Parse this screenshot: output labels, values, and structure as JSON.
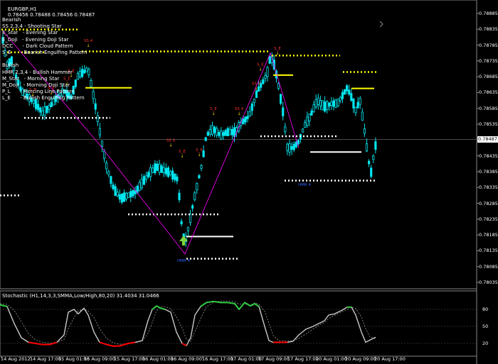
{
  "header": {
    "symbol_label": "EURGBP,H1",
    "ohlc": "0.78456 0.78488 0.78456 0.78487"
  },
  "legend": {
    "lines": [
      "Bearish",
      "SS 2,3,4 - Shooting Star",
      "E_Star   - Evening Star",
      "E_Doji   - Evening Doji Star",
      "DCC      - Dark Cloud Pattern",
      "S_E      - Bearish Engulfing Pattern",
      "",
      "Bullish",
      "HMR 2,3,4 - Bullish Hammer",
      "M_Star   - Morning Star",
      "M_Doji   - Morning Doji Star",
      "P_L      - Piercing Line Pattern",
      "L_E      - Bullish Engulfing Pattern"
    ]
  },
  "stochastic": {
    "title": "Stochastic (H1,14,3,3,SMMA,Low/High,80,20) 31.4034 31.0466"
  },
  "colors": {
    "background": "#000000",
    "candle": "#00e5ee",
    "support_line": "#ffffff",
    "resistance_line": "#ffff00",
    "zigzag": "#ff00ff",
    "stoch_main": "#c8c8c8",
    "stoch_overbought": "#2ecc40",
    "stoch_oversold": "#ff0000",
    "price_tag_bg": "#ffffff"
  },
  "current_price": "0.78487",
  "chart_data": {
    "type": "candlestick",
    "price_axis": [
      "0.78885",
      "0.78835",
      "0.78785",
      "0.78735",
      "0.78685",
      "0.78635",
      "0.78585",
      "0.78535",
      "0.78487",
      "0.78435",
      "0.78385",
      "0.78335",
      "0.78285",
      "0.78235",
      "0.78185",
      "0.78135",
      "0.78085",
      "0.78035"
    ],
    "ylim": [
      0.78015,
      0.78905
    ],
    "time_axis": [
      "14 Aug 2012",
      "14 Aug 17:00",
      "15 Aug 01:00",
      "15 Aug 09:00",
      "15 Aug 17:00",
      "16 Aug 01:00",
      "16 Aug 09:00",
      "16 Aug 17:00",
      "17 Aug 01:00",
      "17 Aug 09:00",
      "17 Aug 17:00",
      "20 Aug 01:00",
      "20 Aug 09:00",
      "20 Aug 17:00"
    ],
    "stoch_levels": [
      "80",
      "50",
      "20"
    ],
    "markers": [
      {
        "label": "SS 4",
        "kind": "bearish"
      },
      {
        "label": "S_E",
        "kind": "bearish"
      },
      {
        "label": "S_E",
        "kind": "bearish"
      },
      {
        "label": "S_E",
        "kind": "bearish"
      },
      {
        "label": "S_E",
        "kind": "bearish"
      },
      {
        "label": "SS 4",
        "kind": "bearish"
      },
      {
        "label": "S_E",
        "kind": "bearish"
      },
      {
        "label": "S_E",
        "kind": "bearish"
      },
      {
        "label": "S_E",
        "kind": "bearish"
      },
      {
        "label": "SS 4",
        "kind": "bearish"
      },
      {
        "label": "SS 4",
        "kind": "bearish"
      },
      {
        "label": "S_E",
        "kind": "bearish"
      },
      {
        "label": "S_E",
        "kind": "bearish"
      },
      {
        "label": "HMR 4",
        "kind": "bullish"
      },
      {
        "label": "HMR 4",
        "kind": "bullish"
      }
    ]
  }
}
